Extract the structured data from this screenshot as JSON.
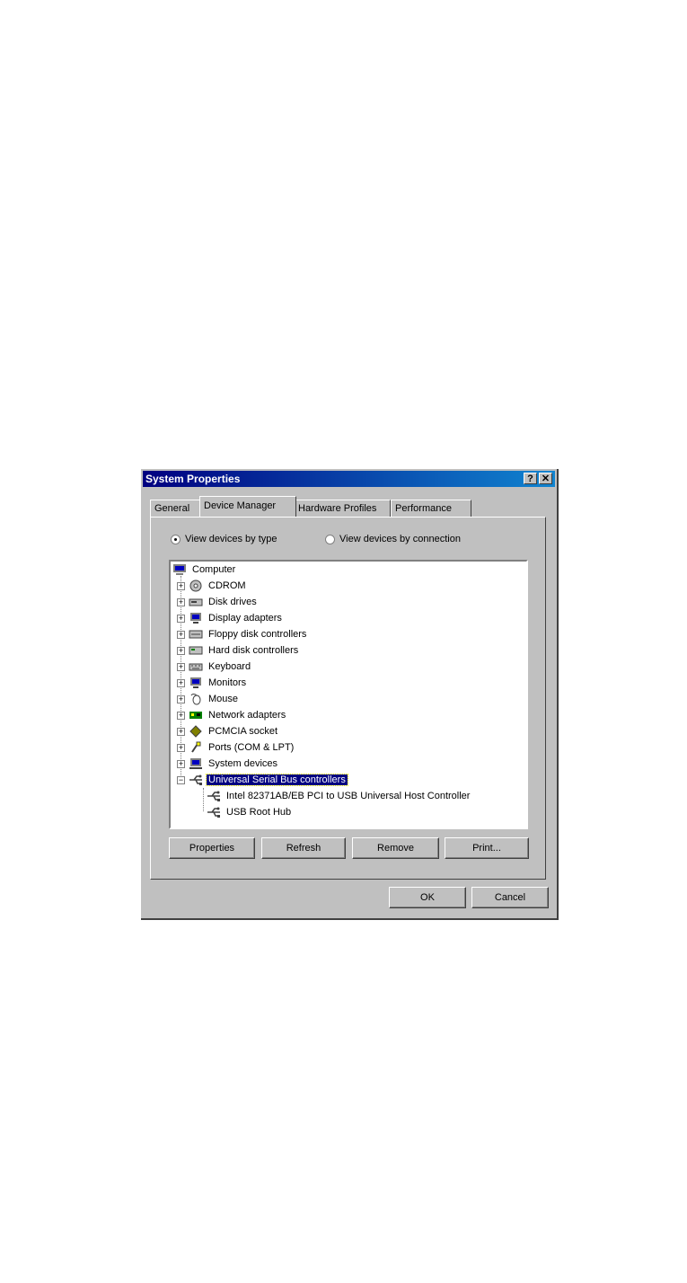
{
  "window": {
    "title": "System Properties",
    "help": "?",
    "close": "✕"
  },
  "tabs": [
    {
      "label": "General"
    },
    {
      "label": "Device Manager"
    },
    {
      "label": "Hardware Profiles"
    },
    {
      "label": "Performance"
    }
  ],
  "radio": {
    "by_type": "View devices by type",
    "by_connection": "View devices by connection"
  },
  "tree": {
    "root": "Computer",
    "items": [
      "CDROM",
      "Disk drives",
      "Display adapters",
      "Floppy disk controllers",
      "Hard disk controllers",
      "Keyboard",
      "Monitors",
      "Mouse",
      "Network adapters",
      "PCMCIA socket",
      "Ports (COM & LPT)",
      "System devices",
      "Universal Serial Bus controllers"
    ],
    "children": [
      "Intel 82371AB/EB PCI to USB Universal Host Controller",
      "USB Root Hub"
    ]
  },
  "buttons": {
    "properties": "Properties",
    "refresh": "Refresh",
    "remove": "Remove",
    "print": "Print...",
    "ok": "OK",
    "cancel": "Cancel"
  }
}
